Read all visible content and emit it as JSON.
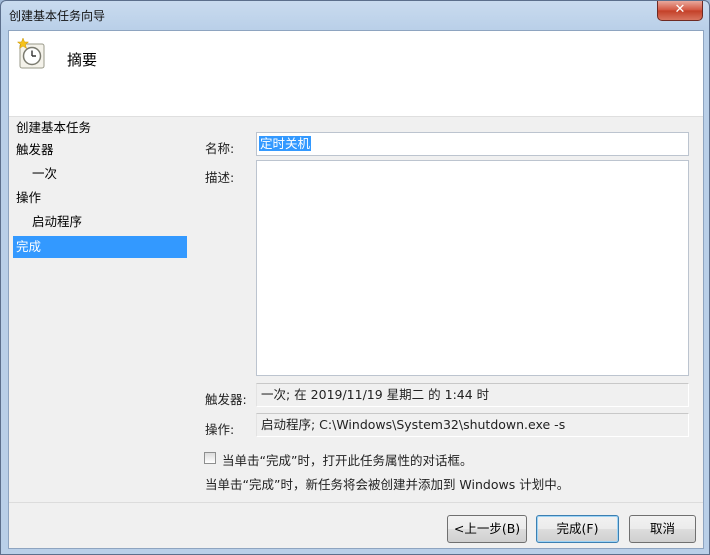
{
  "window": {
    "title": "创建基本任务向导",
    "close_label": "✕"
  },
  "header": {
    "title": "摘要",
    "icon": "task-scheduler-clock-icon"
  },
  "nav": {
    "items": [
      {
        "label": "创建基本任务",
        "level": 0,
        "active": false
      },
      {
        "label": "触发器",
        "level": 0,
        "active": false
      },
      {
        "label": "一次",
        "level": 1,
        "active": false
      },
      {
        "label": "操作",
        "level": 0,
        "active": false
      },
      {
        "label": "启动程序",
        "level": 1,
        "active": false
      },
      {
        "label": "完成",
        "level": 0,
        "active": true
      }
    ]
  },
  "form": {
    "name_label": "名称:",
    "name_value": "定时关机",
    "desc_label": "描述:",
    "desc_value": "",
    "trigger_label": "触发器:",
    "trigger_value": "一次; 在 2019/11/19 星期二 的 1:44 时",
    "action_label": "操作:",
    "action_value": "启动程序; C:\\Windows\\System32\\shutdown.exe -s"
  },
  "checkbox": {
    "label": "当单击“完成”时，打开此任务属性的对话框。",
    "checked": false
  },
  "info_text": "当单击“完成”时，新任务将会被创建并添加到 Windows 计划中。",
  "buttons": {
    "back": "<上一步(B)",
    "finish": "完成(F)",
    "cancel": "取消"
  }
}
